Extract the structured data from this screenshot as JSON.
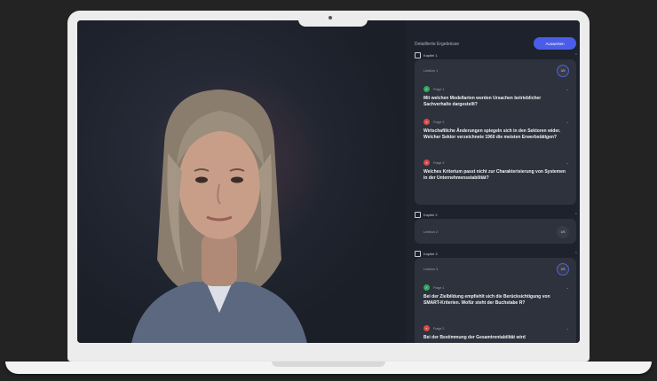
{
  "panel": {
    "title": "Detaillierte Ergebnisse",
    "button_label": "Auswerten",
    "sections": [
      {
        "header": "Kapitel 1",
        "card_label": "Lektion 1",
        "badge": "3/5",
        "questions": [
          {
            "label": "Frage 1",
            "status": "correct",
            "text": "Mit welchen Modellarten werden Ursachen betrieblicher Sachverhalte dargestellt?"
          },
          {
            "label": "Frage 2",
            "status": "wrong",
            "text": "Wirtschaftliche Änderungen spiegeln sich in den Sektoren wider. Welcher Sektor verzeichnete 1960 die meisten Erwerbstätigen?"
          },
          {
            "label": "Frage 3",
            "status": "wrong",
            "text": "Welches Kriterium passt nicht zur Charakterisierung von Systemen in der Unternehmensstabilität?"
          }
        ]
      },
      {
        "header": "Kapitel 2",
        "card_label": "Lektion 2",
        "badge": "4/5"
      },
      {
        "header": "Kapitel 3",
        "card_label": "Lektion 3",
        "badge": "2/5",
        "questions": [
          {
            "label": "Frage 1",
            "status": "correct",
            "text": "Bei der Zielbildung empfiehlt sich die Berücksichtigung von SMART-Kriterien. Wofür steht der Buchstabe R?"
          },
          {
            "label": "Frage 2",
            "status": "wrong",
            "text": "Bei der Bestimmung der Gesamtrentabilität wird"
          }
        ]
      }
    ]
  },
  "icons": {
    "correct": "check-icon",
    "wrong": "x-icon",
    "expand": "chevron-down-icon",
    "collapse": "chevron-up-icon"
  },
  "colors": {
    "accent": "#4a5dea",
    "correct": "#2fa85a",
    "wrong": "#d84a4a",
    "background": "#1b1f28"
  }
}
